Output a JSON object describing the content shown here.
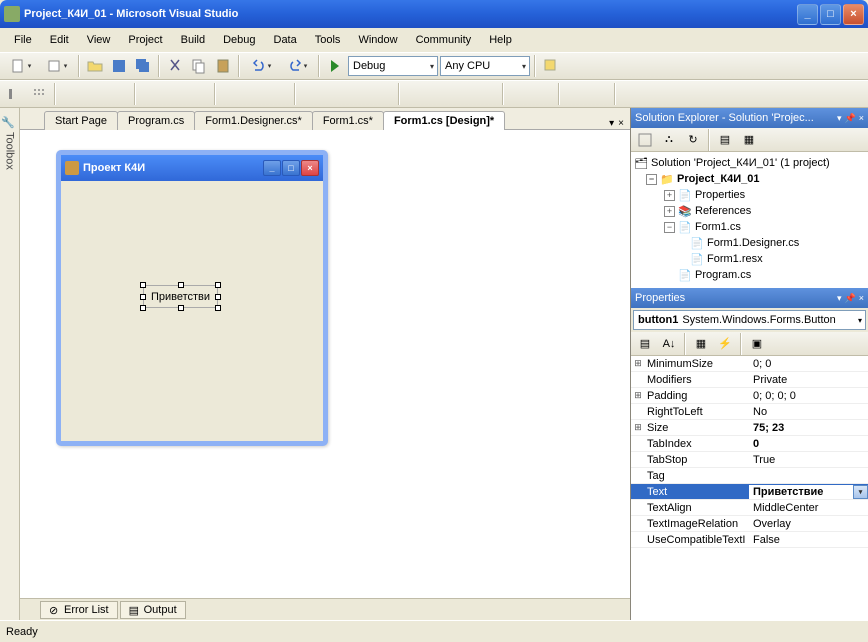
{
  "window": {
    "title": "Project_К4И_01 - Microsoft Visual Studio"
  },
  "menu": [
    "File",
    "Edit",
    "View",
    "Project",
    "Build",
    "Debug",
    "Data",
    "Tools",
    "Window",
    "Community",
    "Help"
  ],
  "toolbar_combos": {
    "config": "Debug",
    "platform": "Any CPU"
  },
  "toolbox": {
    "label": "Toolbox"
  },
  "tabs": [
    {
      "label": "Start Page",
      "active": false
    },
    {
      "label": "Program.cs",
      "active": false
    },
    {
      "label": "Form1.Designer.cs*",
      "active": false
    },
    {
      "label": "Form1.cs*",
      "active": false
    },
    {
      "label": "Form1.cs [Design]*",
      "active": true
    }
  ],
  "form": {
    "title": "Проект К4И",
    "button_text": "Приветстви"
  },
  "bottom_tabs": [
    "Error List",
    "Output"
  ],
  "solution_explorer": {
    "title": "Solution Explorer - Solution 'Projec...",
    "root": "Solution 'Project_К4И_01' (1 project)",
    "project": "Project_К4И_01",
    "nodes": [
      "Properties",
      "References",
      "Form1.cs"
    ],
    "form_children": [
      "Form1.Designer.cs",
      "Form1.resx"
    ],
    "last": "Program.cs"
  },
  "properties": {
    "title": "Properties",
    "selected_object": "button1 System.Windows.Forms.Button",
    "rows": [
      {
        "exp": "⊞",
        "name": "MinimumSize",
        "val": "0; 0"
      },
      {
        "exp": "",
        "name": "Modifiers",
        "val": "Private"
      },
      {
        "exp": "⊞",
        "name": "Padding",
        "val": "0; 0; 0; 0"
      },
      {
        "exp": "",
        "name": "RightToLeft",
        "val": "No"
      },
      {
        "exp": "⊞",
        "name": "Size",
        "val": "75; 23",
        "bold": true
      },
      {
        "exp": "",
        "name": "TabIndex",
        "val": "0",
        "bold": true
      },
      {
        "exp": "",
        "name": "TabStop",
        "val": "True"
      },
      {
        "exp": "",
        "name": "Tag",
        "val": ""
      },
      {
        "exp": "",
        "name": "Text",
        "val": "Приветствие",
        "bold": true,
        "selected": true
      },
      {
        "exp": "",
        "name": "TextAlign",
        "val": "MiddleCenter"
      },
      {
        "exp": "",
        "name": "TextImageRelation",
        "val": "Overlay"
      },
      {
        "exp": "",
        "name": "UseCompatibleTextI",
        "val": "False"
      }
    ]
  },
  "status": "Ready"
}
